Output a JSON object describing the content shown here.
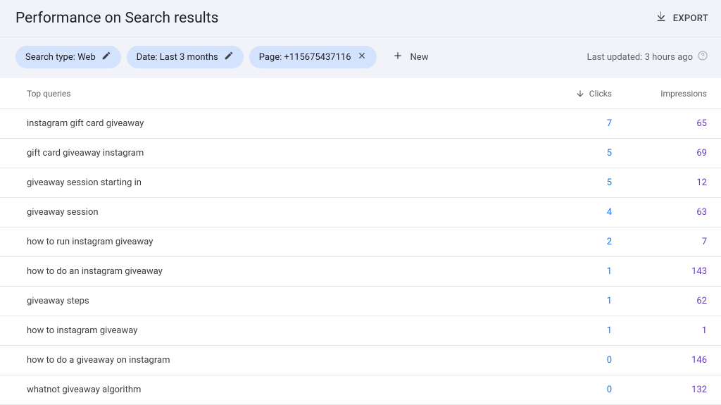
{
  "header": {
    "title": "Performance on Search results",
    "export_label": "EXPORT"
  },
  "filters": {
    "search_type": "Search type: Web",
    "date": "Date: Last 3 months",
    "page": "Page: +115675437116",
    "new_label": "New",
    "last_updated": "Last updated: 3 hours ago"
  },
  "table": {
    "header": {
      "queries": "Top queries",
      "clicks": "Clicks",
      "impressions": "Impressions"
    },
    "rows": [
      {
        "query": "instagram gift card giveaway",
        "clicks": "7",
        "impr": "65"
      },
      {
        "query": "gift card giveaway instagram",
        "clicks": "5",
        "impr": "69"
      },
      {
        "query": "giveaway session starting in",
        "clicks": "5",
        "impr": "12"
      },
      {
        "query": "giveaway session",
        "clicks": "4",
        "impr": "63"
      },
      {
        "query": "how to run instagram giveaway",
        "clicks": "2",
        "impr": "7"
      },
      {
        "query": "how to do an instagram giveaway",
        "clicks": "1",
        "impr": "143"
      },
      {
        "query": "giveaway steps",
        "clicks": "1",
        "impr": "62"
      },
      {
        "query": "how to instagram giveaway",
        "clicks": "1",
        "impr": "1"
      },
      {
        "query": "how to do a giveaway on instagram",
        "clicks": "0",
        "impr": "146"
      },
      {
        "query": "whatnot giveaway algorithm",
        "clicks": "0",
        "impr": "132"
      }
    ]
  },
  "icons": {
    "pencil": "pencil-icon",
    "close": "close-icon",
    "plus": "plus-icon",
    "download": "download-icon",
    "help": "help-icon",
    "arrow_down": "arrow-down-icon"
  }
}
